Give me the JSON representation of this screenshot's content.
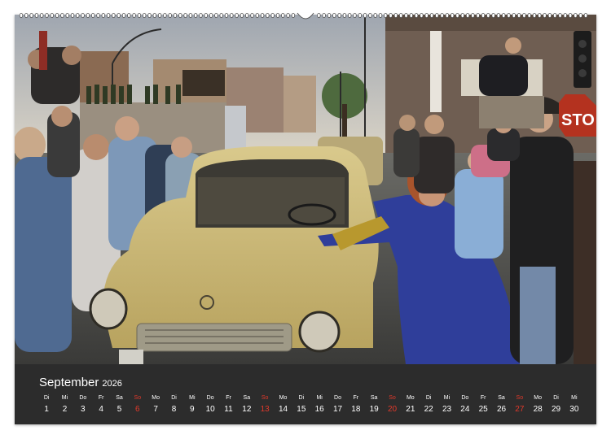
{
  "calendar": {
    "month": "September",
    "year": "2026",
    "days": [
      {
        "wd": "Di",
        "n": "1"
      },
      {
        "wd": "Mi",
        "n": "2"
      },
      {
        "wd": "Do",
        "n": "3"
      },
      {
        "wd": "Fr",
        "n": "4"
      },
      {
        "wd": "Sa",
        "n": "5"
      },
      {
        "wd": "So",
        "n": "6"
      },
      {
        "wd": "Mo",
        "n": "7"
      },
      {
        "wd": "Di",
        "n": "8"
      },
      {
        "wd": "Mi",
        "n": "9"
      },
      {
        "wd": "Do",
        "n": "10"
      },
      {
        "wd": "Fr",
        "n": "11"
      },
      {
        "wd": "Sa",
        "n": "12"
      },
      {
        "wd": "So",
        "n": "13"
      },
      {
        "wd": "Mo",
        "n": "14"
      },
      {
        "wd": "Di",
        "n": "15"
      },
      {
        "wd": "Mi",
        "n": "16"
      },
      {
        "wd": "Do",
        "n": "17"
      },
      {
        "wd": "Fr",
        "n": "18"
      },
      {
        "wd": "Sa",
        "n": "19"
      },
      {
        "wd": "So",
        "n": "20"
      },
      {
        "wd": "Mo",
        "n": "21"
      },
      {
        "wd": "Di",
        "n": "22"
      },
      {
        "wd": "Mi",
        "n": "23"
      },
      {
        "wd": "Do",
        "n": "24"
      },
      {
        "wd": "Fr",
        "n": "25"
      },
      {
        "wd": "Sa",
        "n": "26"
      },
      {
        "wd": "So",
        "n": "27"
      },
      {
        "wd": "Mo",
        "n": "28"
      },
      {
        "wd": "Di",
        "n": "29"
      },
      {
        "wd": "Mi",
        "n": "30"
      }
    ],
    "sunday_color": "#e0392b",
    "text_color": "#ffffff"
  },
  "photo": {
    "sign_text": "STO"
  }
}
